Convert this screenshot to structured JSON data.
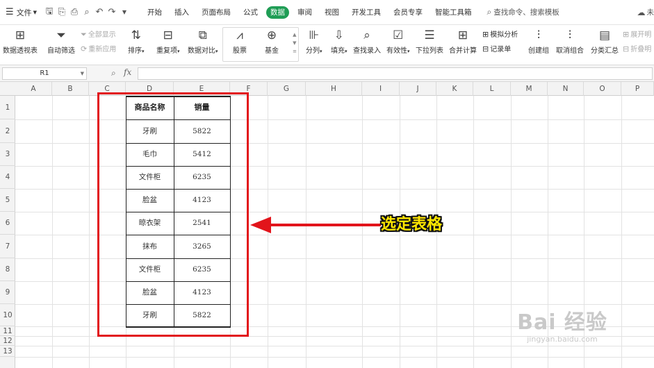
{
  "menubar": {
    "file_menu": "文件",
    "tabs": [
      "开始",
      "插入",
      "页面布局",
      "公式",
      "数据",
      "审阅",
      "视图",
      "开发工具",
      "会员专享",
      "智能工具箱"
    ],
    "active_tab": "数据",
    "search": "查找命令、搜索模板",
    "right_text": "未"
  },
  "ribbon": {
    "pivot": "数据透视表",
    "autofilter": "自动筛选",
    "show_all": "全部显示",
    "reapply": "重新应用",
    "sort": "排序",
    "duplicates": "重复项",
    "compare": "数据对比",
    "stock": "股票",
    "fund": "基金",
    "split": "分列",
    "fill": "填充",
    "lookup": "查找录入",
    "validity": "有效性",
    "dropdown": "下拉列表",
    "consolidate": "合并计算",
    "whatif": "模拟分析",
    "record": "记录单",
    "group": "创建组",
    "ungroup": "取消组合",
    "subtotal": "分类汇总",
    "expand": "展开明",
    "collapse": "折叠明"
  },
  "formula": {
    "name_box": "R1",
    "fx": "fx"
  },
  "grid": {
    "columns": [
      "A",
      "B",
      "C",
      "D",
      "E",
      "F",
      "G",
      "H",
      "I",
      "J",
      "K",
      "L",
      "M",
      "N",
      "O",
      "P"
    ],
    "rows": [
      "1",
      "2",
      "3",
      "4",
      "5",
      "6",
      "7",
      "8",
      "9",
      "10",
      "11",
      "12",
      "13"
    ]
  },
  "table": {
    "headers": [
      "商品名称",
      "销量"
    ],
    "rows": [
      [
        "牙刷",
        "5822"
      ],
      [
        "毛巾",
        "5412"
      ],
      [
        "文件柜",
        "6235"
      ],
      [
        "脸盆",
        "4123"
      ],
      [
        "晾衣架",
        "2541"
      ],
      [
        "抹布",
        "3265"
      ],
      [
        "文件柜",
        "6235"
      ],
      [
        "脸盆",
        "4123"
      ],
      [
        "牙刷",
        "5822"
      ]
    ]
  },
  "annotation": {
    "text": "选定表格",
    "color": "#ffe600",
    "frame_color": "#e2141b"
  },
  "watermark": {
    "line1": "Bai 经验",
    "line2": "jingyan.baidu.com"
  },
  "colors": {
    "active_tab": "#1f9d55",
    "highlight": "#e2141b"
  }
}
